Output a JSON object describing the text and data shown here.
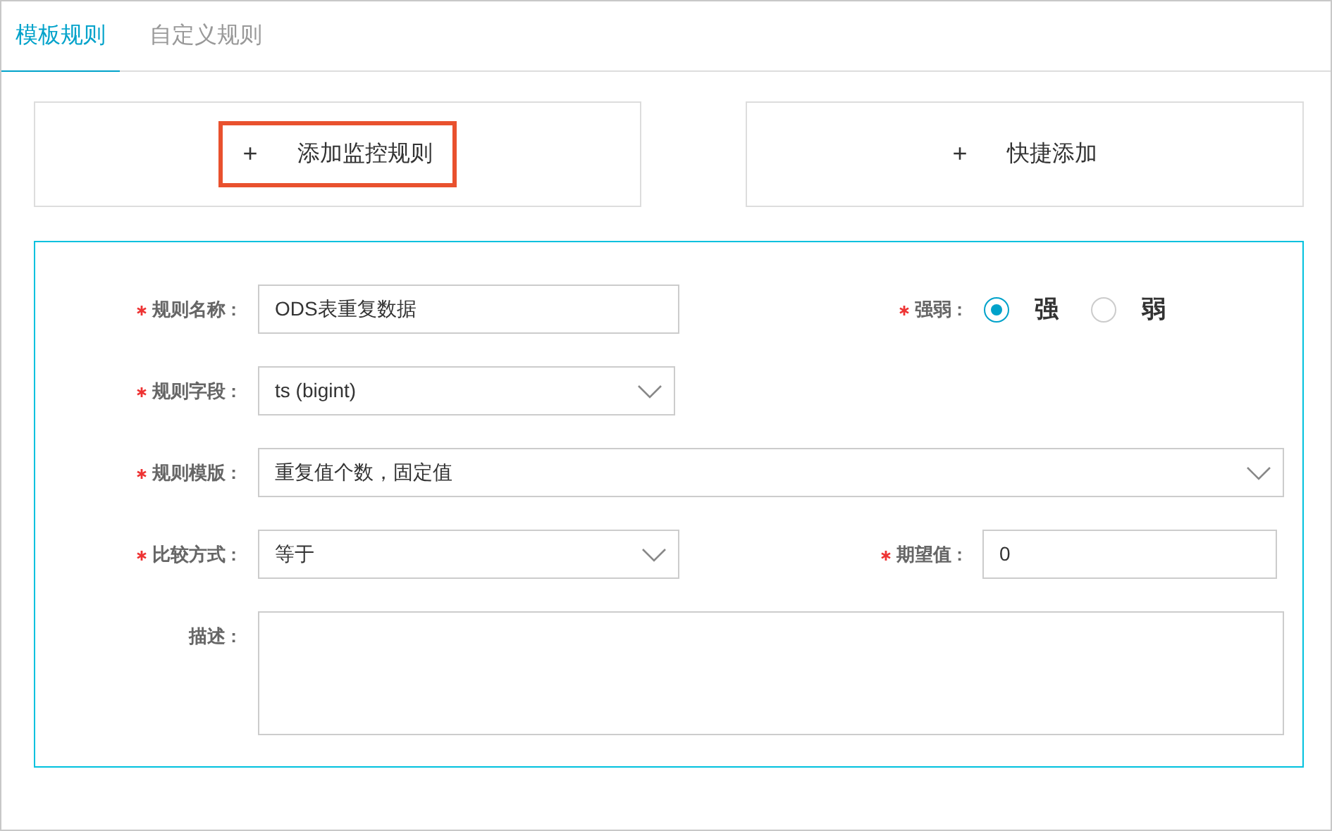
{
  "tabs": [
    {
      "label": "模板规则",
      "selected": true
    },
    {
      "label": "自定义规则",
      "selected": false
    }
  ],
  "actions": [
    {
      "icon": "+",
      "label": "添加监控规则",
      "highlighted": true
    },
    {
      "icon": "+",
      "label": "快捷添加",
      "highlighted": false
    }
  ],
  "form": {
    "rows": [
      {
        "fields": [
          {
            "kind": "input",
            "label": "规则名称 :",
            "required": true,
            "value": "ODS表重复数据"
          },
          {
            "kind": "radio",
            "label": "强弱 :",
            "required": true,
            "options": [
              {
                "label": "强",
                "selected": true
              },
              {
                "label": "弱",
                "selected": false
              }
            ]
          }
        ]
      },
      {
        "fields": [
          {
            "kind": "select",
            "label": "规则字段 :",
            "required": true,
            "value": "ts (bigint)"
          }
        ]
      },
      {
        "fields": [
          {
            "kind": "select",
            "label": "规则模版 :",
            "required": true,
            "value": "重复值个数，固定值"
          }
        ]
      },
      {
        "fields": [
          {
            "kind": "select",
            "label": "比较方式 :",
            "required": true,
            "value": "等于"
          },
          {
            "kind": "input",
            "label": "期望值 :",
            "required": true,
            "value": "0"
          }
        ]
      },
      {
        "fields": [
          {
            "kind": "textarea",
            "label": "描述 :",
            "required": false
          }
        ]
      }
    ]
  }
}
